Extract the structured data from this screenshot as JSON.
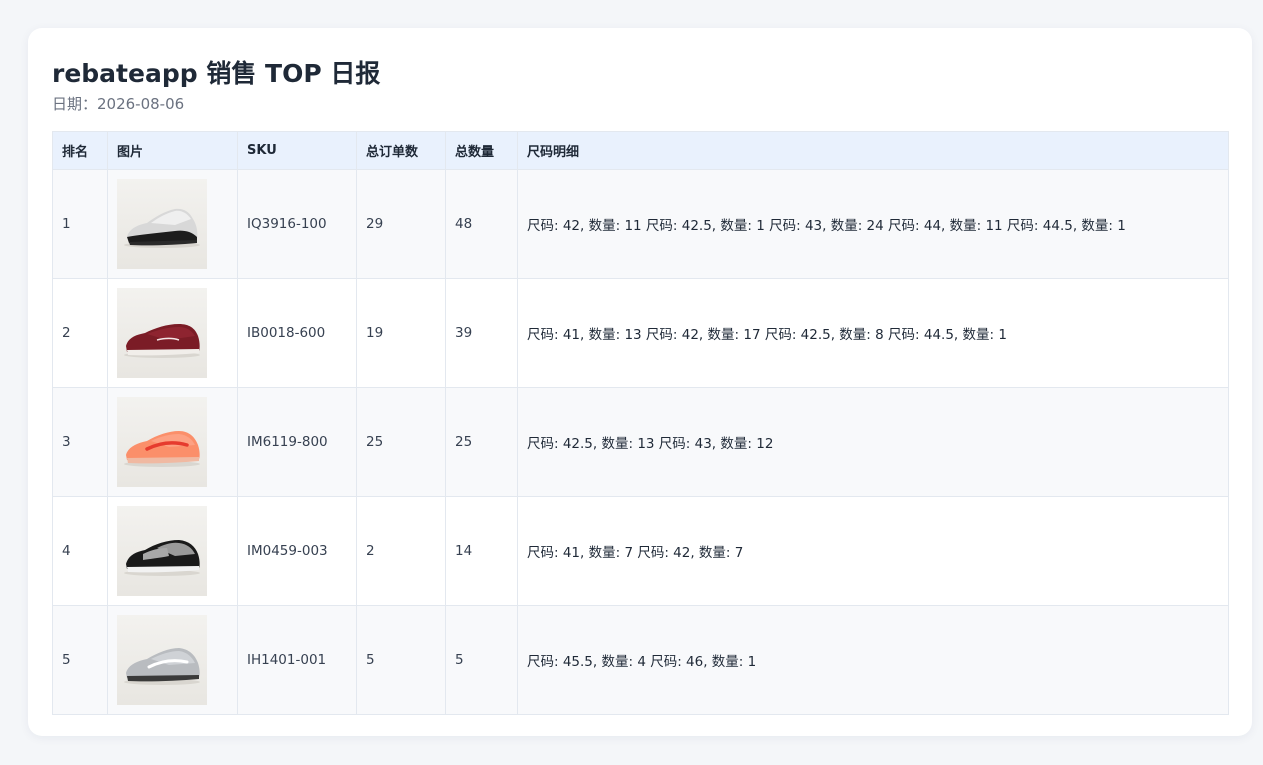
{
  "report": {
    "title": "rebateapp 销售 TOP 日报",
    "date": "日期：2026-08-06"
  },
  "table": {
    "headers": {
      "rank": "排名",
      "image": "图片",
      "sku": "SKU",
      "orders": "总订单数",
      "quantity": "总数量",
      "sizes": "尺码明细"
    },
    "rows": [
      {
        "rank": "1",
        "sku": "IQ3916-100",
        "orders": "29",
        "quantity": "48",
        "sizes": "尺码: 42, 数量: 11 尺码: 42.5, 数量: 1 尺码: 43, 数量: 24 尺码: 44, 数量: 11 尺码: 44.5, 数量: 1",
        "image_icon": "sneaker-black-white-icon"
      },
      {
        "rank": "2",
        "sku": "IB0018-600",
        "orders": "19",
        "quantity": "39",
        "sizes": "尺码: 41, 数量: 13 尺码: 42, 数量: 17 尺码: 42.5, 数量: 8 尺码: 44.5, 数量: 1",
        "image_icon": "sneaker-burgundy-icon"
      },
      {
        "rank": "3",
        "sku": "IM6119-800",
        "orders": "25",
        "quantity": "25",
        "sizes": "尺码: 42.5, 数量: 13 尺码: 43, 数量: 12",
        "image_icon": "sneaker-orange-icon"
      },
      {
        "rank": "4",
        "sku": "IM0459-003",
        "orders": "2",
        "quantity": "14",
        "sizes": "尺码: 41, 数量: 7 尺码: 42, 数量: 7",
        "image_icon": "sneaker-black-grey-icon"
      },
      {
        "rank": "5",
        "sku": "IH1401-001",
        "orders": "5",
        "quantity": "5",
        "sizes": "尺码: 45.5, 数量: 4 尺码: 46, 数量: 1",
        "image_icon": "sneaker-light-grey-icon"
      }
    ]
  },
  "colors": {
    "header_bg": "#e9f1fd",
    "row_alt_bg": "#f8f9fb",
    "border": "#e3e8ef"
  }
}
